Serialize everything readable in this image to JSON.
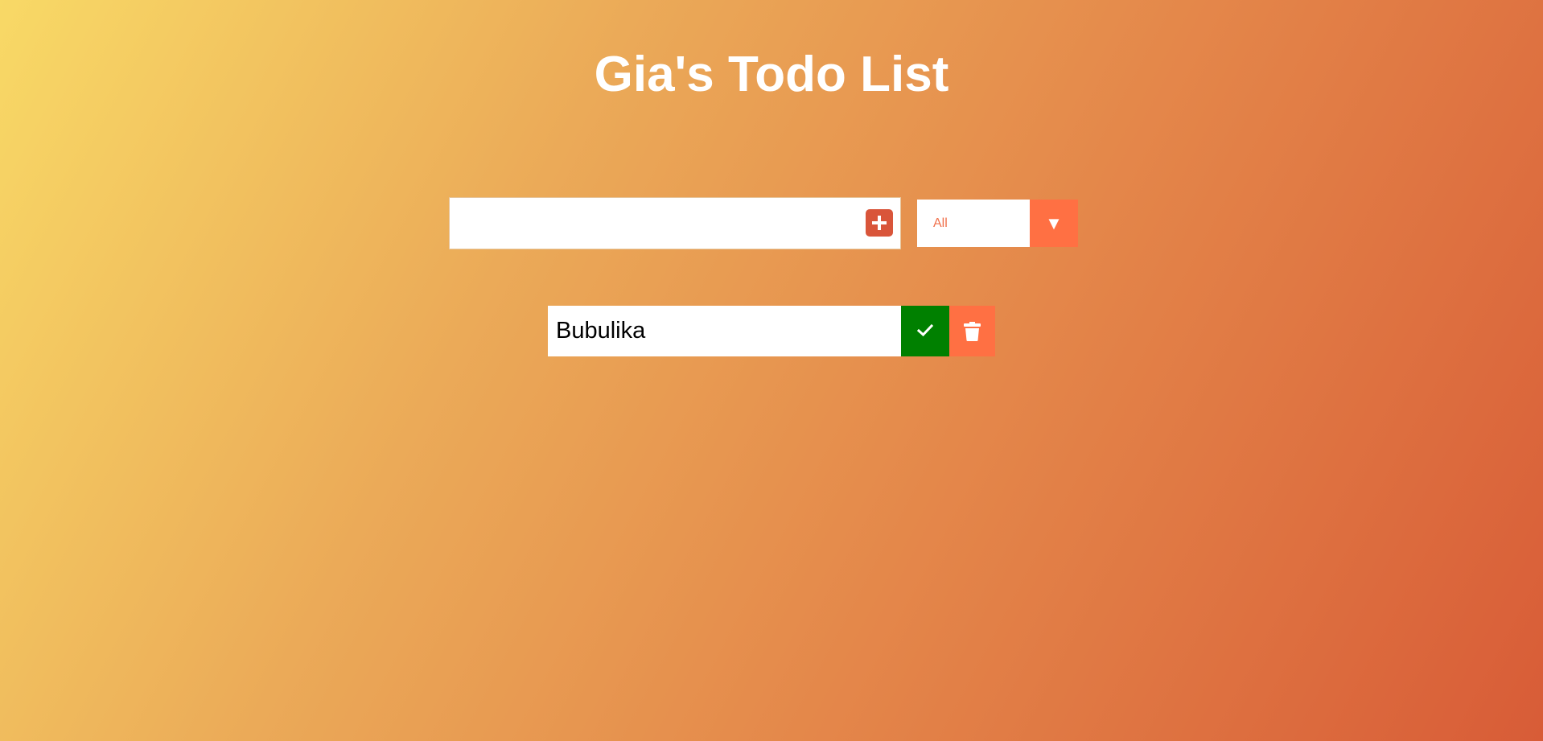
{
  "header": {
    "title": "Gia's Todo List"
  },
  "form": {
    "input_value": "",
    "placeholder": "",
    "add_icon": "plus-icon",
    "filter": {
      "selected": "All",
      "arrow_glyph": "▼"
    }
  },
  "todos": [
    {
      "text": "Bubulika",
      "complete_icon": "check-icon",
      "delete_icon": "trash-icon"
    }
  ],
  "colors": {
    "gradient_start": "#f8d966",
    "gradient_end": "#d85c37",
    "add_button": "#d9553a",
    "accent": "#ff7043",
    "complete": "#008000"
  }
}
